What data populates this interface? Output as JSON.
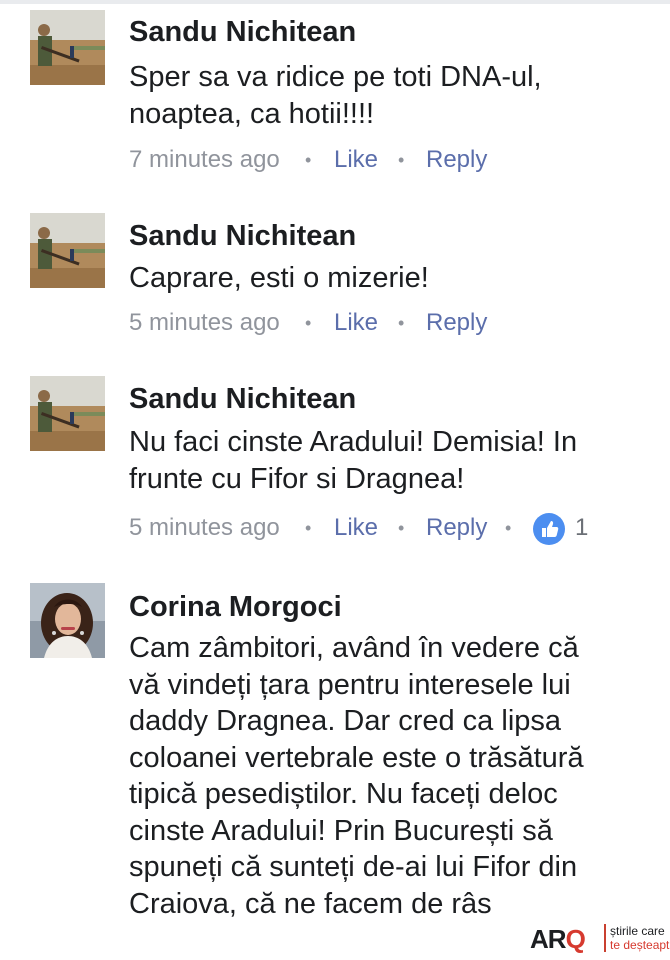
{
  "comments": [
    {
      "author": "Sandu Nichitean",
      "lines": [
        "Sper sa va ridice pe toti DNA-ul,",
        "noaptea, ca hotii!!!!"
      ],
      "time": "7 minutes ago",
      "like_label": "Like",
      "reply_label": "Reply",
      "avatar_icon": "hunter-field-photo"
    },
    {
      "author": "Sandu Nichitean",
      "lines": [
        "Caprare, esti o mizerie!"
      ],
      "time": "5 minutes ago",
      "like_label": "Like",
      "reply_label": "Reply",
      "avatar_icon": "hunter-field-photo"
    },
    {
      "author": "Sandu Nichitean",
      "lines": [
        "Nu faci cinste Aradului! Demisia! In",
        "frunte cu Fifor si Dragnea!"
      ],
      "time": "5 minutes ago",
      "like_label": "Like",
      "reply_label": "Reply",
      "reaction_count": "1",
      "reaction_icon": "thumbs-up-icon",
      "avatar_icon": "hunter-field-photo"
    },
    {
      "author": "Corina Morgoci",
      "lines": [
        "Cam zâmbitori, având în vedere că",
        "vă vindeți țara pentru interesele lui",
        "daddy Dragnea. Dar cred ca lipsa",
        "coloanei vertebrale este o trăsătură",
        "tipică pesediștilor. Nu faceți deloc",
        "cinste Aradului! Prin București să",
        "spuneți că sunteți de-ai lui Fifor din",
        "Craiova, că ne facem de râs"
      ],
      "avatar_icon": "woman-portrait-photo"
    }
  ],
  "separator": "•",
  "watermark": {
    "logo_main": "AR",
    "logo_accent": "Q",
    "tagline_1": "știrile care",
    "tagline_2": "te deșteaptă"
  },
  "colors": {
    "text": "#1c1e21",
    "meta": "#90949c",
    "link": "#5b6eab",
    "like_badge": "#4c8ef0",
    "brand_red": "#d63a2f"
  }
}
